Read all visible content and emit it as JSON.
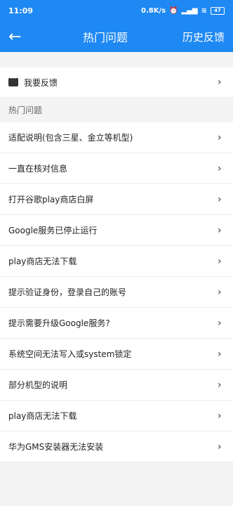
{
  "status_bar": {
    "time": "11:09",
    "speed": "0.8K/s",
    "battery": "47"
  },
  "header": {
    "title": "热门问题",
    "history": "历史反馈"
  },
  "feedback": {
    "label": "我要反馈"
  },
  "section": {
    "title": "热门问题"
  },
  "items": [
    "适配说明(包含三星、金立等机型)",
    "一直在核对信息",
    "打开谷歌play商店白屏",
    "Google服务已停止运行",
    "play商店无法下载",
    "提示验证身份，登录自己的账号",
    "提示需要升级Google服务?",
    "系统空间无法写入或system锁定",
    "部分机型的说明",
    "play商店无法下载",
    "华为GMS安装器无法安装"
  ]
}
